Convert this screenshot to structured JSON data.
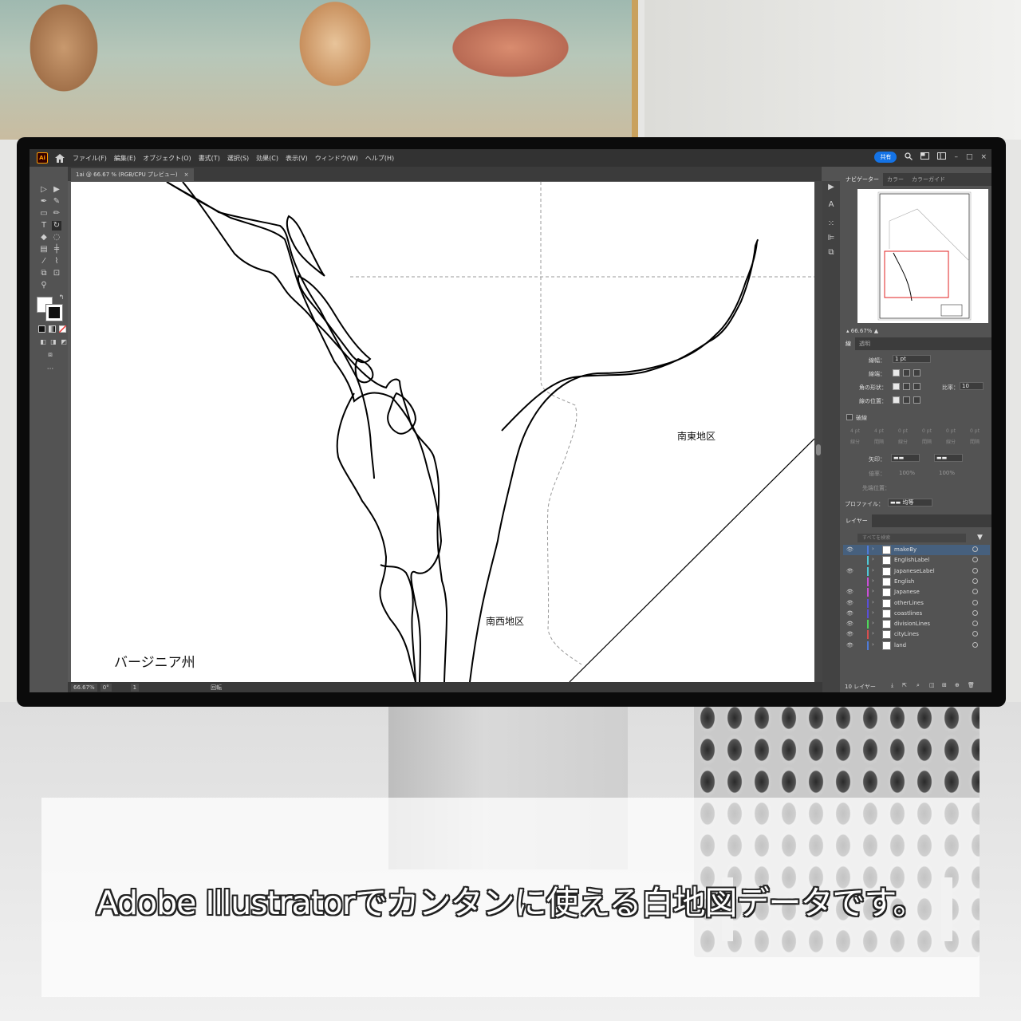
{
  "menubar": {
    "logo_label": "Ai",
    "items": [
      "ファイル(F)",
      "編集(E)",
      "オブジェクト(O)",
      "書式(T)",
      "選択(S)",
      "効果(C)",
      "表示(V)",
      "ウィンドウ(W)",
      "ヘルプ(H)"
    ],
    "share_label": "共有"
  },
  "document_tab": {
    "title": "1ai @ 66.67 % (RGB/CPU プレビュー)",
    "close_glyph": "×"
  },
  "map": {
    "label_southeast": "南東地区",
    "label_southwest": "南西地区",
    "label_virginia": "バージニア州"
  },
  "status_bar": {
    "zoom": "66.67%",
    "rotation": "0°",
    "page": "1",
    "mode": "回転"
  },
  "panels": {
    "navigator_tabs": [
      "ナビゲーター",
      "カラー",
      "カラーガイド"
    ],
    "navigator_zoom": "66.67%",
    "stroke_tabs": [
      "線",
      "透明"
    ],
    "stroke": {
      "weight_label": "線幅：",
      "weight_value": "1 pt",
      "cap_label": "線端：",
      "corner_label": "角の形状：",
      "limit_label": "比率：",
      "limit_value": "10",
      "align_label": "線の位置：",
      "dashed_label": "破線",
      "dash_values": [
        "4 pt",
        "4 pt",
        "0 pt",
        "0 pt",
        "0 pt",
        "0 pt"
      ],
      "dash_captions": [
        "線分",
        "間隔",
        "線分",
        "間隔",
        "線分",
        "間隔"
      ],
      "arrow_label": "矢印：",
      "scale_label": "倍率：",
      "scale_values": [
        "100%",
        "100%"
      ],
      "arrow_align_label": "先端位置：",
      "profile_label": "プロファイル：",
      "profile_value": "均等"
    },
    "layers_tab": "レイヤー",
    "layers_search_placeholder": "すべてを検索",
    "layers": [
      {
        "name": "makeBy",
        "visible": true,
        "color": "#4f7bd8",
        "selected": true
      },
      {
        "name": "EnglishLabel",
        "visible": false,
        "color": "#4fc9d8",
        "selected": false
      },
      {
        "name": "JapaneseLabel",
        "visible": true,
        "color": "#4fc9d8",
        "selected": false
      },
      {
        "name": "English",
        "visible": false,
        "color": "#c94fd8",
        "selected": false
      },
      {
        "name": "Japanese",
        "visible": true,
        "color": "#c94fd8",
        "selected": false
      },
      {
        "name": "otherLines",
        "visible": true,
        "color": "#5a4fd8",
        "selected": false
      },
      {
        "name": "coastlines",
        "visible": true,
        "color": "#5a4fd8",
        "selected": false
      },
      {
        "name": "divisionLines",
        "visible": true,
        "color": "#4fd85a",
        "selected": false
      },
      {
        "name": "cityLines",
        "visible": true,
        "color": "#d84f4f",
        "selected": false
      },
      {
        "name": "land",
        "visible": true,
        "color": "#4f7bd8",
        "selected": false
      }
    ],
    "layers_count": "10 レイヤー"
  },
  "caption": "Adobe Illustratorでカンタンに使える白地図データです。"
}
